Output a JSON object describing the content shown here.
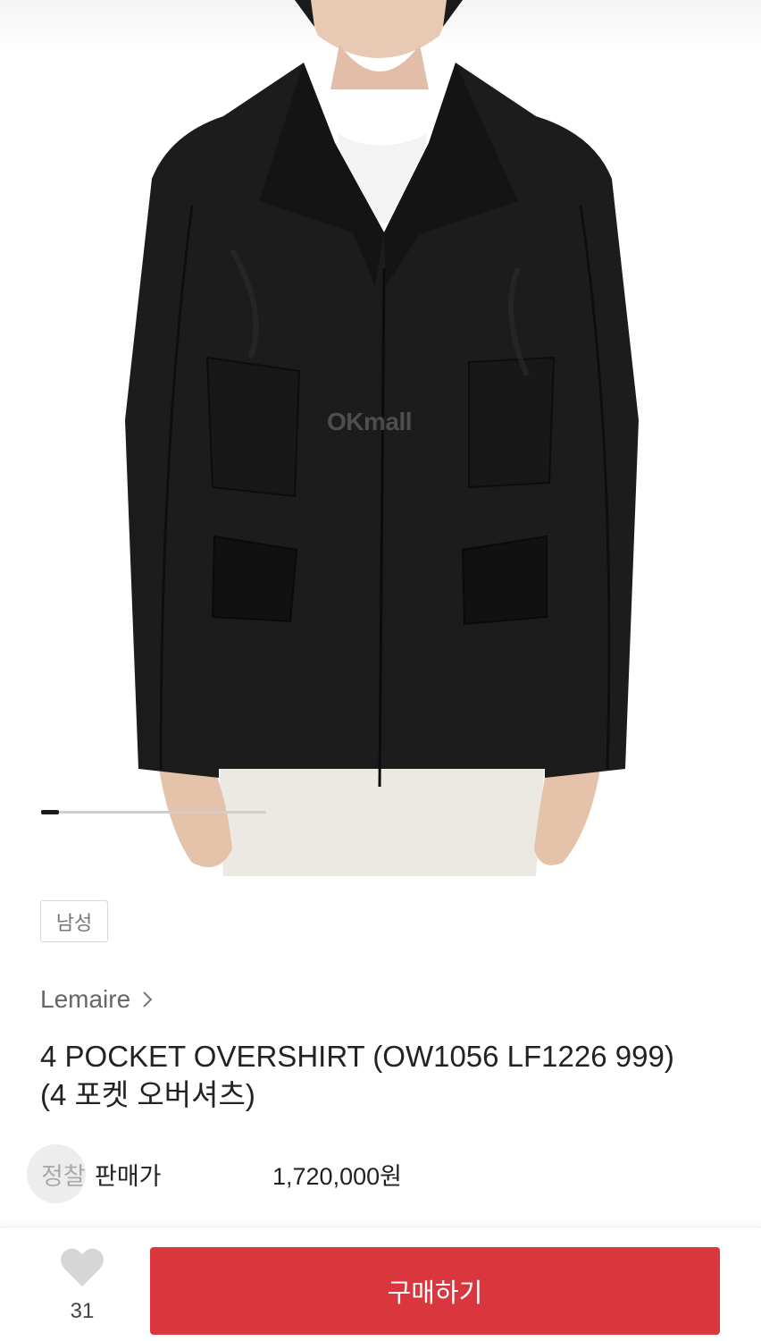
{
  "product_image": {
    "alt": "Black 4 pocket overshirt on model",
    "watermark": "OKmall",
    "carousel_progress": 0.08
  },
  "category_chip": "남성",
  "brand": {
    "name": "Lemaire",
    "chevron_icon": "chevron-right-icon"
  },
  "product": {
    "title": "4 POCKET OVERSHIRT (OW1056 LF1226 999) (4 포켓 오버셔츠)"
  },
  "price": {
    "badge": "정찰",
    "label": "판매가",
    "value": "1,720,000원"
  },
  "bottom_bar": {
    "like_icon": "heart-icon",
    "like_count": "31",
    "buy_label": "구매하기"
  },
  "colors": {
    "buy_button": "#d9363e",
    "heart": "#d6d6d6"
  }
}
